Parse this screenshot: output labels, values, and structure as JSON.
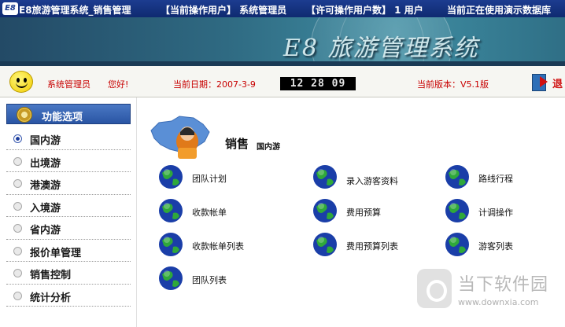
{
  "titlebar": {
    "app_title": "E8旅游管理系统_销售管理",
    "current_user": "【当前操作用户】 系统管理员",
    "license_users": "【许可操作用户数】 1 用户",
    "database_status": "当前正在使用演示数据库"
  },
  "banner": {
    "brand": "E8 旅游管理系统"
  },
  "infobar": {
    "user_name": "系统管理员",
    "greeting": "您好!",
    "date_label": "当前日期：2007-3-9",
    "clock": "12 28 09",
    "version_label": "当前版本：V5.1版",
    "exit_label": "退"
  },
  "sidebar": {
    "header": "功能选项",
    "items": [
      {
        "label": "国内游"
      },
      {
        "label": "出境游"
      },
      {
        "label": "港澳游"
      },
      {
        "label": "入境游"
      },
      {
        "label": "省内游"
      },
      {
        "label": "报价单管理"
      },
      {
        "label": "销售控制"
      },
      {
        "label": "统计分析"
      }
    ]
  },
  "content": {
    "section_title": "销售",
    "section_subtitle": "国内游",
    "functions": [
      {
        "label": "团队计划"
      },
      {
        "label": "录入游客资料"
      },
      {
        "label": "路线行程"
      },
      {
        "label": "收款帐单"
      },
      {
        "label": "费用预算"
      },
      {
        "label": "计调操作"
      },
      {
        "label": "收款帐单列表"
      },
      {
        "label": "费用预算列表"
      },
      {
        "label": "游客列表"
      },
      {
        "label": "团队列表"
      }
    ]
  },
  "watermark": {
    "name": "当下软件园",
    "url": "www.downxia.com"
  }
}
